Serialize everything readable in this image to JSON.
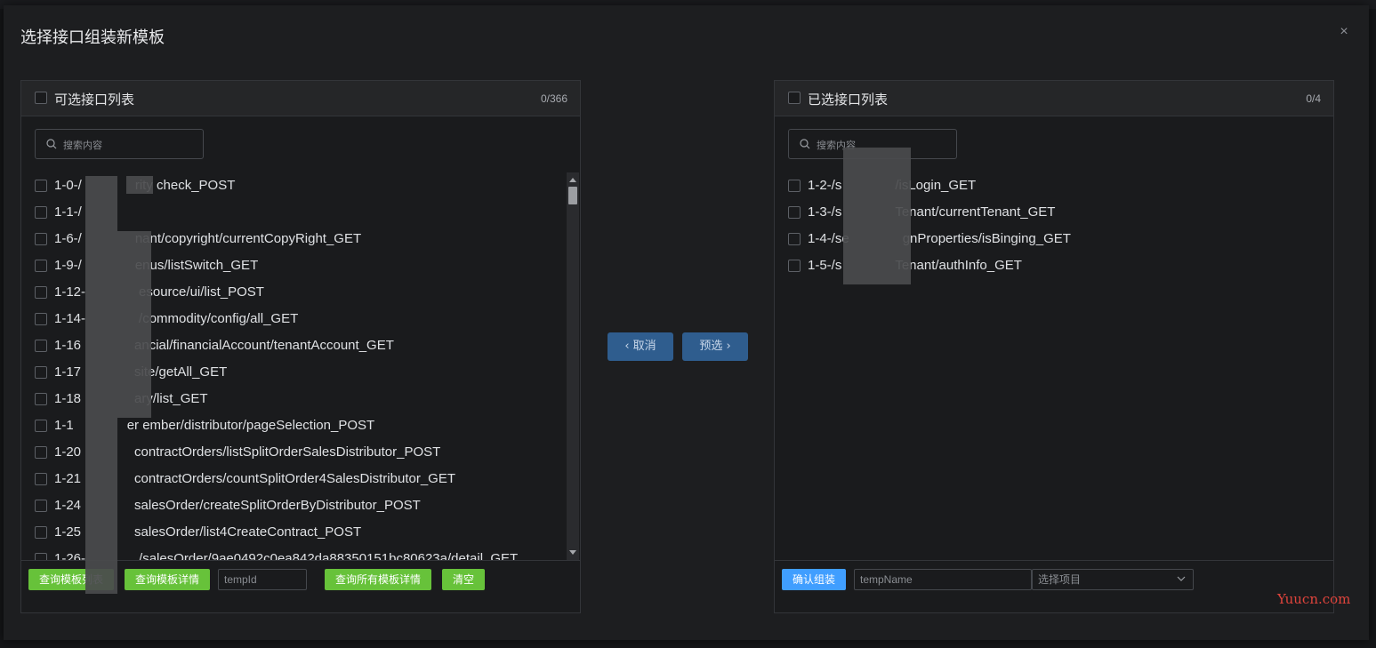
{
  "dialog": {
    "title": "选择接口组装新模板",
    "close_icon": "×"
  },
  "left_panel": {
    "title": "可选接口列表",
    "count": "0/366",
    "search_placeholder": "搜索内容",
    "items": [
      "1-0-/",
      "1-1-/",
      "1-6-/",
      "1-9-/",
      "1-12-",
      "1-14-",
      "1-16",
      "1-17",
      "1-18",
      "1-1",
      "1-20",
      "1-21",
      "1-24",
      "1-25",
      "1-26-"
    ],
    "item_suffixes": [
      "rity check_POST",
      "",
      "nant/copyright/currentCopyRight_GET",
      "enus/listSwitch_GET",
      "esource/ui/list_POST",
      "/commodity/config/all_GET",
      "ancial/financialAccount/tenantAccount_GET",
      "site/getAll_GET",
      "ary/list_GET",
      "er ember/distributor/pageSelection_POST",
      "contractOrders/listSplitOrderSalesDistributor_POST",
      "contractOrders/countSplitOrder4SalesDistributor_GET",
      "salesOrder/createSplitOrderByDistributor_POST",
      "salesOrder/list4CreateContract_POST",
      "/salesOrder/9ae0492c0ea842da88350151bc80623a/detail_GET"
    ],
    "footer": {
      "btn_template_list": "查询模板列表",
      "btn_template_detail": "查询模板详情",
      "tempid_placeholder": "tempId",
      "btn_all_template_detail": "查询所有模板详情",
      "btn_clear": "清空"
    }
  },
  "right_panel": {
    "title": "已选接口列表",
    "count": "0/4",
    "search_placeholder": "搜索内容",
    "items": [
      "1-2-/s",
      "1-3-/s",
      "1-4-/se",
      "1-5-/s"
    ],
    "item_suffixes": [
      "/isLogin_GET",
      "Tenant/currentTenant_GET",
      "gnProperties/isBinging_GET",
      "Tenant/authInfo_GET"
    ],
    "footer": {
      "btn_confirm": "确认组装",
      "tempname_placeholder": "tempName",
      "select_placeholder": "选择项目"
    }
  },
  "transfer": {
    "cancel_label": "取消",
    "preselect_label": "预选"
  },
  "watermark": "Yuucn.com",
  "colors": {
    "green": "#67c23a",
    "blue": "#409eff",
    "transfer_blue": "#2f5d8e"
  }
}
